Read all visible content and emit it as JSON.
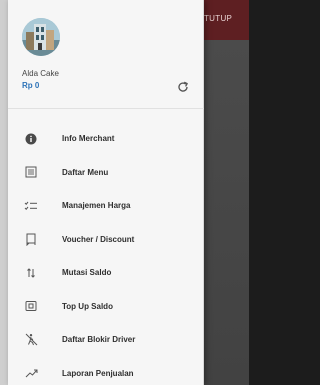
{
  "background": {
    "topbar_label": "TUTUP",
    "topbar_color": "#5e1f22"
  },
  "drawer": {
    "profile": {
      "name": "Alda Cake",
      "balance": "Rp 0"
    },
    "menu": [
      {
        "label": "Info Merchant",
        "icon": "info-icon"
      },
      {
        "label": "Daftar Menu",
        "icon": "list-icon"
      },
      {
        "label": "Manajemen Harga",
        "icon": "price-list-icon"
      },
      {
        "label": "Voucher / Discount",
        "icon": "voucher-icon"
      },
      {
        "label": "Mutasi Saldo",
        "icon": "transfer-arrows-icon"
      },
      {
        "label": "Top Up Saldo",
        "icon": "wallet-icon"
      },
      {
        "label": "Daftar Blokir Driver",
        "icon": "blocked-driver-icon"
      },
      {
        "label": "Laporan Penjualan",
        "icon": "trending-up-icon"
      }
    ],
    "accent_color": "#2d73b8"
  }
}
